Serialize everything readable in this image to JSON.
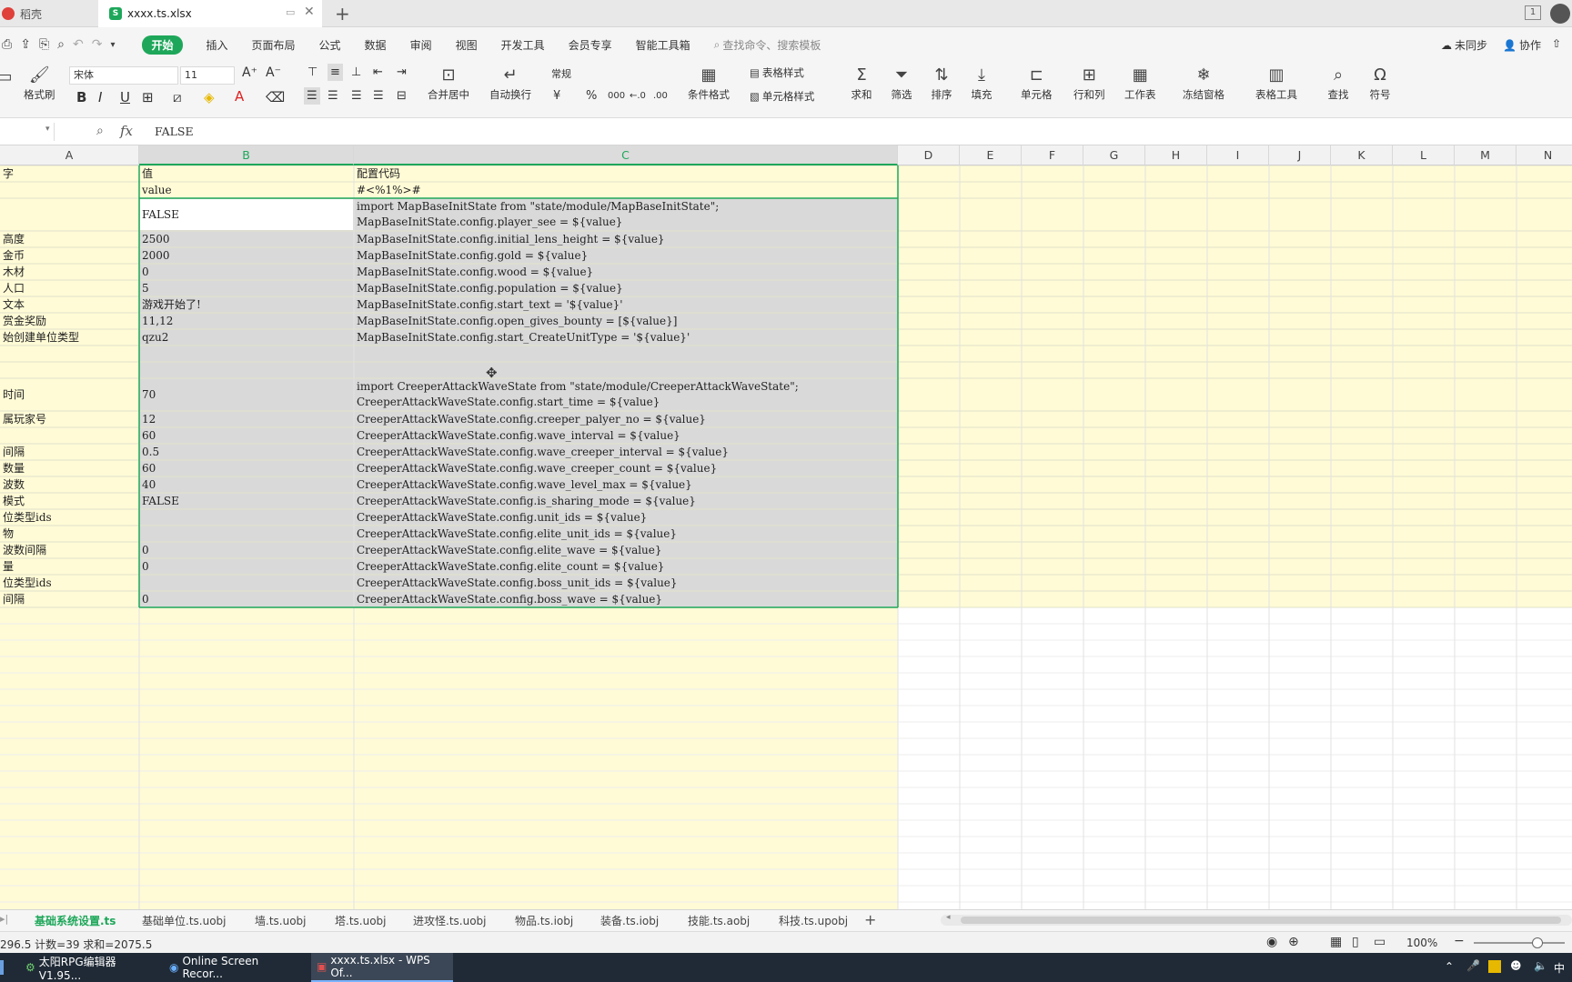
{
  "tabs": [
    {
      "label": "稻壳",
      "active": false
    },
    {
      "label": "xxxx.ts.xlsx",
      "active": true
    }
  ],
  "new_tab_label": "+",
  "window_badge": "1",
  "menu": {
    "items": [
      "开始",
      "插入",
      "页面布局",
      "公式",
      "数据",
      "审阅",
      "视图",
      "开发工具",
      "会员专享",
      "智能工具箱"
    ],
    "active_index": 0,
    "search_placeholder": "查找命令、搜索模板",
    "unsync_label": "未同步",
    "collab_label": "协作"
  },
  "ribbon": {
    "format_painter": "格式刷",
    "font_name": "宋体",
    "font_size": "11",
    "number_format": "常规",
    "merge_center": "合并居中",
    "wrap_text": "自动换行",
    "conditional_format": "条件格式",
    "table_style": "表格样式",
    "cell_style": "单元格样式",
    "sum": "求和",
    "filter": "筛选",
    "sort": "排序",
    "fill": "填充",
    "cells": "单元格",
    "rows_cols": "行和列",
    "worksheet": "工作表",
    "freeze": "冻结窗格",
    "table_tools": "表格工具",
    "find": "查找",
    "symbol": "符号",
    "currency_symbol": "¥",
    "percent_symbol": "%",
    "thousands_symbol": "000",
    "inc_decimal": "←.0",
    "dec_decimal": ".00"
  },
  "formula": {
    "fx": "fx",
    "value": "FALSE"
  },
  "columns": [
    "A",
    "B",
    "C",
    "D",
    "E",
    "F",
    "G",
    "H",
    "I",
    "J",
    "K",
    "L",
    "M",
    "N"
  ],
  "rows": [
    {
      "a": "字",
      "b": "值",
      "c": [
        "配置代码"
      ]
    },
    {
      "a": "",
      "b": "value",
      "c": [
        "#<%1%>#"
      ]
    },
    {
      "a": "",
      "b": "FALSE",
      "c": [
        "import MapBaseInitState from \"state/module/MapBaseInitState\";",
        "MapBaseInitState.config.player_see = ${value}"
      ]
    },
    {
      "a": "高度",
      "b": "2500",
      "c": [
        "MapBaseInitState.config.initial_lens_height = ${value}"
      ]
    },
    {
      "a": "金币",
      "b": "2000",
      "c": [
        "MapBaseInitState.config.gold = ${value}"
      ]
    },
    {
      "a": "木材",
      "b": "0",
      "c": [
        "MapBaseInitState.config.wood = ${value}"
      ]
    },
    {
      "a": "人口",
      "b": "5",
      "c": [
        "MapBaseInitState.config.population = ${value}"
      ]
    },
    {
      "a": "文本",
      "b": "游戏开始了!",
      "c": [
        "MapBaseInitState.config.start_text = '${value}'"
      ]
    },
    {
      "a": "赏金奖励",
      "b": "11,12",
      "c": [
        "MapBaseInitState.config.open_gives_bounty = [${value}]"
      ]
    },
    {
      "a": "始创建单位类型",
      "b": "qzu2",
      "c": [
        "MapBaseInitState.config.start_CreateUnitType = '${value}'"
      ]
    },
    {
      "a": "",
      "b": "",
      "c": [
        ""
      ]
    },
    {
      "a": "",
      "b": "",
      "c": [
        ""
      ]
    },
    {
      "a": "时间",
      "b": "70",
      "c": [
        "import CreeperAttackWaveState from \"state/module/CreeperAttackWaveState\";",
        "CreeperAttackWaveState.config.start_time = ${value}"
      ]
    },
    {
      "a": "属玩家号",
      "b": "12",
      "c": [
        "CreeperAttackWaveState.config.creeper_palyer_no = ${value}"
      ]
    },
    {
      "a": "",
      "b": "60",
      "c": [
        "CreeperAttackWaveState.config.wave_interval = ${value}"
      ]
    },
    {
      "a": "间隔",
      "b": "0.5",
      "c": [
        "CreeperAttackWaveState.config.wave_creeper_interval = ${value}"
      ]
    },
    {
      "a": "数量",
      "b": "60",
      "c": [
        "CreeperAttackWaveState.config.wave_creeper_count = ${value}"
      ]
    },
    {
      "a": "波数",
      "b": "40",
      "c": [
        "CreeperAttackWaveState.config.wave_level_max = ${value}"
      ]
    },
    {
      "a": "模式",
      "b": "FALSE",
      "c": [
        "CreeperAttackWaveState.config.is_sharing_mode = ${value}"
      ]
    },
    {
      "a": "位类型ids",
      "b": "",
      "c": [
        "CreeperAttackWaveState.config.unit_ids = ${value}"
      ]
    },
    {
      "a": "物",
      "b": "",
      "c": [
        "CreeperAttackWaveState.config.elite_unit_ids = ${value}"
      ]
    },
    {
      "a": "波数间隔",
      "b": "0",
      "c": [
        "CreeperAttackWaveState.config.elite_wave = ${value}"
      ]
    },
    {
      "a": "量",
      "b": "0",
      "c": [
        "CreeperAttackWaveState.config.elite_count = ${value}"
      ]
    },
    {
      "a": "位类型ids",
      "b": "",
      "c": [
        "CreeperAttackWaveState.config.boss_unit_ids = ${value}"
      ]
    },
    {
      "a": "间隔",
      "b": "0",
      "c": [
        "CreeperAttackWaveState.config.boss_wave = ${value}"
      ]
    }
  ],
  "sheets": [
    "基础系统设置.ts",
    "基础单位.ts.uobj",
    "墙.ts.uobj",
    "塔.ts.uobj",
    "进攻怪.ts.uobj",
    "物品.ts.iobj",
    "装备.ts.iobj",
    "技能.ts.aobj",
    "科技.ts.upobj"
  ],
  "add_sheet": "+",
  "status": {
    "summary": "296.5  计数=39  求和=2075.5",
    "zoom": "100%"
  },
  "taskbar": [
    {
      "label": "太阳RPG编辑器V1.95...",
      "active": false
    },
    {
      "label": "Online Screen Recor...",
      "active": false
    },
    {
      "label": "xxxx.ts.xlsx - WPS Of...",
      "active": true
    }
  ],
  "tray_ime": "中",
  "colors": {
    "accent": "#1ea75a",
    "cell_yellow": "#fffbd6",
    "selection_gray": "#d9d9d9"
  }
}
